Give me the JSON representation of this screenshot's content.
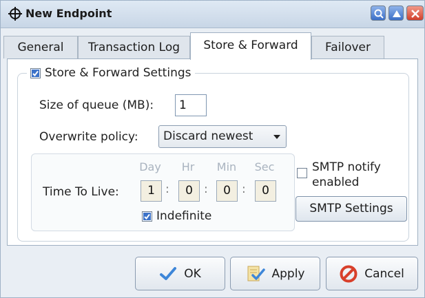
{
  "window": {
    "title": "New Endpoint"
  },
  "tabs": [
    {
      "label": "General"
    },
    {
      "label": "Transaction Log"
    },
    {
      "label": "Store & Forward",
      "active": true
    },
    {
      "label": "Failover"
    }
  ],
  "store_forward": {
    "settings_label": "Store & Forward Settings",
    "settings_checked": true,
    "queue_label": "Size of queue (MB):",
    "queue_value": "1",
    "overwrite_label": "Overwrite policy:",
    "overwrite_value": "Discard newest",
    "ttl": {
      "label": "Time To Live:",
      "units": [
        "Day",
        "Hr",
        "Min",
        "Sec"
      ],
      "values": [
        "1",
        "0",
        "0",
        "0"
      ],
      "indefinite_label": "Indefinite",
      "indefinite_checked": true
    },
    "smtp": {
      "notify_label_line1": "SMTP notify",
      "notify_label_line2": "enabled",
      "notify_checked": false,
      "settings_button": "SMTP Settings"
    }
  },
  "buttons": {
    "ok": "OK",
    "apply": "Apply",
    "cancel": "Cancel"
  },
  "colors": {
    "accent": "#3d73c9",
    "cancel_icon": "#d8402b",
    "ok_check": "#3d86d8"
  }
}
